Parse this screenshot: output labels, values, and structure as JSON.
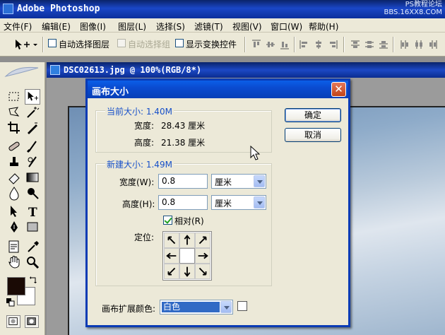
{
  "app": {
    "title": "Adobe Photoshop",
    "watermark_line1": "PS教程论坛",
    "watermark_line2": "BBS.16XX8.COM"
  },
  "menu": [
    "文件(F)",
    "编辑(E)",
    "图像(I)",
    "图层(L)",
    "选择(S)",
    "滤镜(T)",
    "视图(V)",
    "窗口(W)",
    "帮助(H)"
  ],
  "options": {
    "auto_select_layer": "自动选择图层",
    "auto_select_group": "自动选择组",
    "show_transform": "显示变换控件"
  },
  "document": {
    "title": "DSC02613.jpg @ 100%(RGB/8*)"
  },
  "dialog": {
    "title": "画布大小",
    "close_glyph": "✕",
    "current_group": "当前大小: 1.40M",
    "current_width_label": "宽度:",
    "current_width_value": "28.43 厘米",
    "current_height_label": "高度:",
    "current_height_value": "21.38 厘米",
    "new_group": "新建大小: 1.49M",
    "width_label": "宽度(W):",
    "width_value": "0.8",
    "width_unit": "厘米",
    "height_label": "高度(H):",
    "height_value": "0.8",
    "height_unit": "厘米",
    "relative_label": "相对(R)",
    "relative_checked": true,
    "anchor_label": "定位:",
    "ok_label": "确定",
    "cancel_label": "取消",
    "ext_color_label": "画布扩展颜色:",
    "ext_color_value": "白色"
  }
}
